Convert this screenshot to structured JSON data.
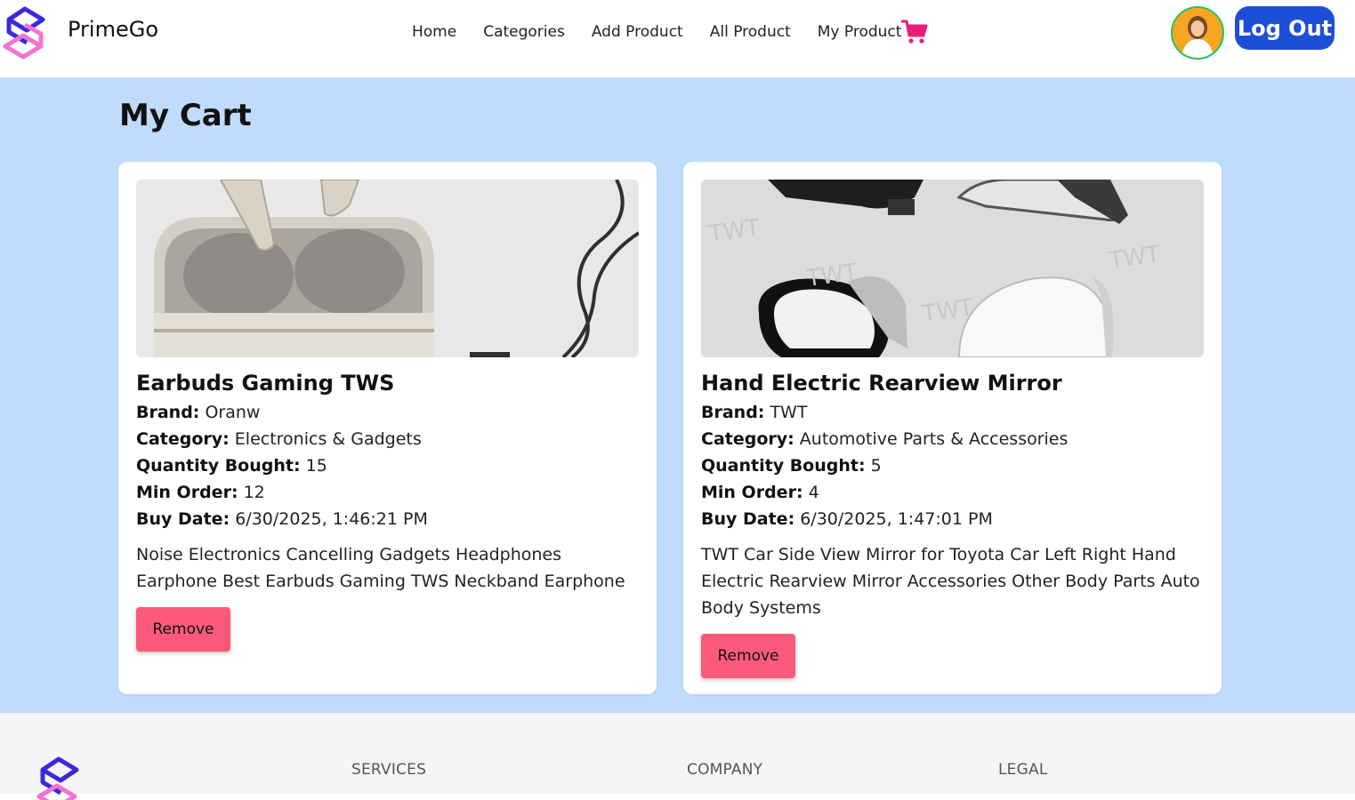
{
  "header": {
    "brand": "PrimeGo",
    "nav": [
      "Home",
      "Categories",
      "Add Product",
      "All Product",
      "My Product"
    ],
    "logout_label": "Log Out"
  },
  "page": {
    "title": "My Cart"
  },
  "labels": {
    "brand": "Brand:",
    "category": "Category:",
    "quantity": "Quantity Bought:",
    "min_order": "Min Order:",
    "buy_date": "Buy Date:"
  },
  "cart_items": [
    {
      "name": "Earbuds Gaming TWS",
      "brand": "Oranw",
      "category": "Electronics & Gadgets",
      "quantity": "15",
      "min_order": "12",
      "buy_date": "6/30/2025, 1:46:21 PM",
      "description": "Noise Electronics Cancelling Gadgets Headphones Earphone Best Earbuds Gaming TWS Neckband Earphone",
      "remove_label": "Remove"
    },
    {
      "name": "Hand Electric Rearview Mirror",
      "brand": "TWT",
      "category": "Automotive Parts & Accessories",
      "quantity": "5",
      "min_order": "4",
      "buy_date": "6/30/2025, 1:47:01 PM",
      "description": "TWT Car Side View Mirror for Toyota Car Left Right Hand Electric Rearview Mirror Accessories Other Body Parts Auto Body Systems",
      "remove_label": "Remove"
    }
  ],
  "footer": {
    "sections": [
      "SERVICES",
      "COMPANY",
      "LEGAL"
    ]
  },
  "colors": {
    "accent": "#1d4ed8",
    "main_bg": "#bfdbfe",
    "remove": "#fb5a7c",
    "cart": "#ec1c7a"
  },
  "icons": {
    "logo": "primego-logo-icon",
    "cart": "shopping-cart-icon",
    "avatar": "user-avatar"
  }
}
